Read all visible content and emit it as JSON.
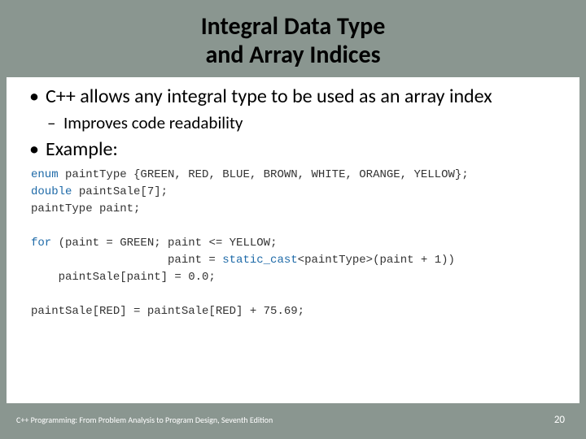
{
  "title": {
    "line1": "Integral Data Type",
    "line2": "and Array Indices"
  },
  "bullets": {
    "b1": "C++ allows any integral type to be used as an array index",
    "b1_sub1": "Improves code readability",
    "b2": "Example:"
  },
  "code": {
    "kw_enum": "enum",
    "line1_rest": " paintType {GREEN, RED, BLUE, BROWN, WHITE, ORANGE, YELLOW};",
    "kw_double": "double",
    "line2_rest": " paintSale[7];",
    "line3": "paintType paint;",
    "blank1": " ",
    "kw_for": "for",
    "line5_rest": " (paint = GREEN; paint <= YELLOW;",
    "line6a": "                    paint = ",
    "kw_cast": "static_cast",
    "line6b": "<paintType>(paint + 1))",
    "line7": "    paintSale[paint] = 0.0;",
    "blank2": " ",
    "line9": "paintSale[RED] = paintSale[RED] + 75.69;"
  },
  "footer": {
    "text": "C++ Programming: From Problem Analysis to Program Design, Seventh Edition",
    "page": "20"
  }
}
